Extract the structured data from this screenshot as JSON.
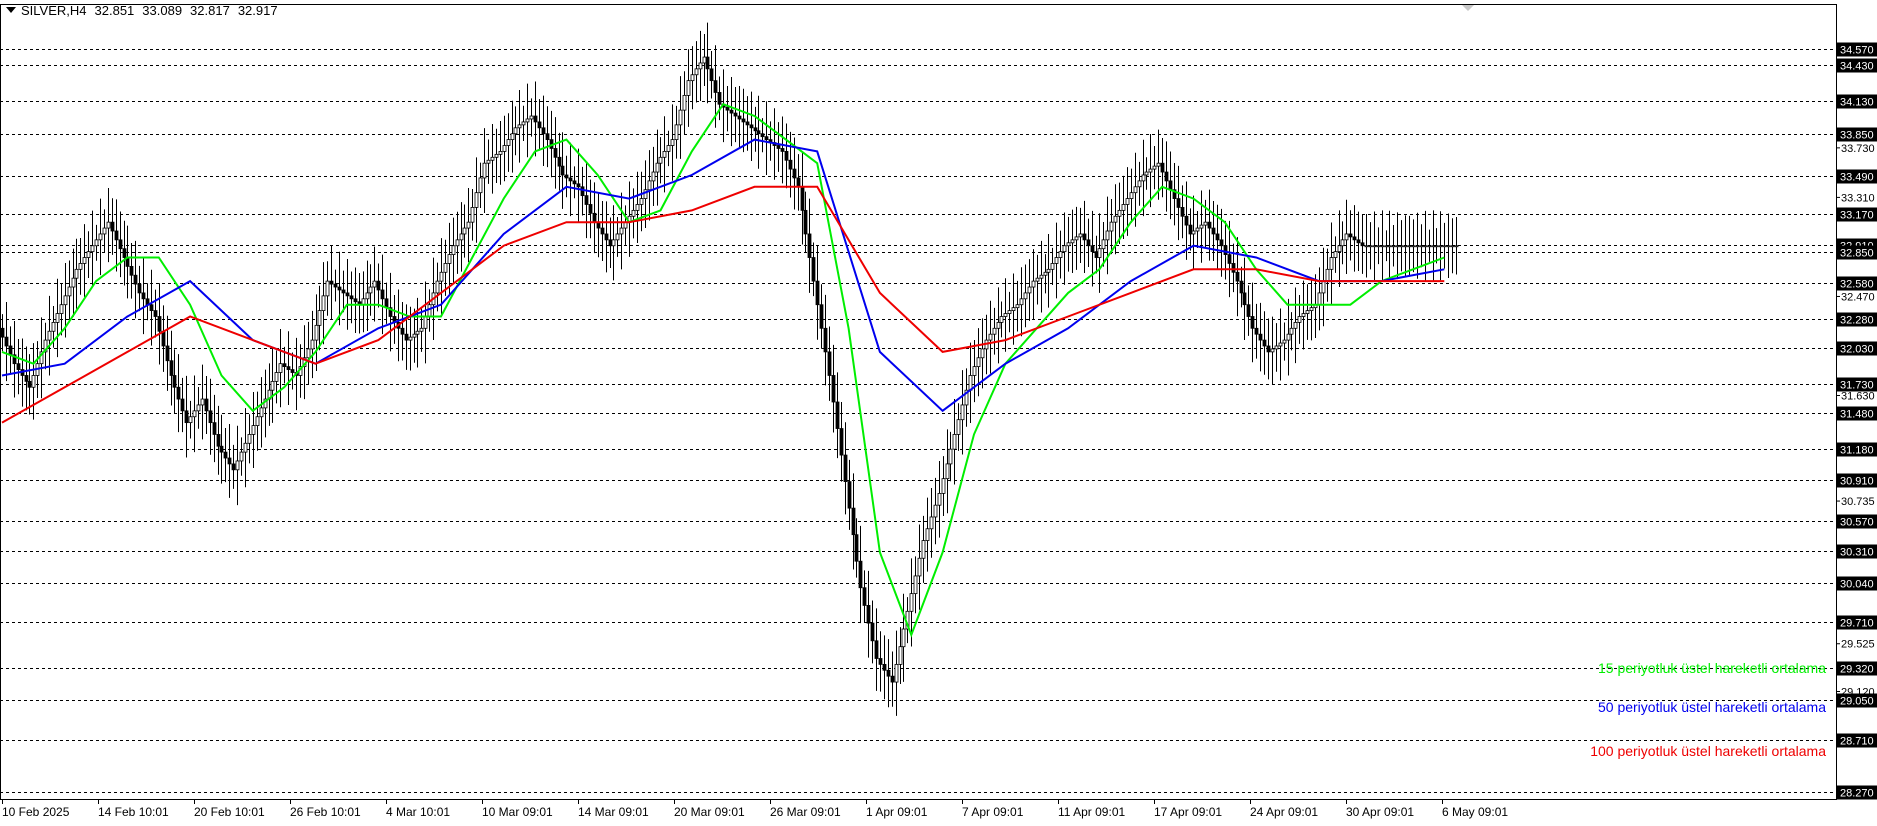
{
  "header": {
    "symbol": "SILVER,H4",
    "open": "32.851",
    "high": "33.089",
    "low": "32.817",
    "close": "32.917"
  },
  "legend": [
    {
      "label": "15 periyotluk üstel hareketli ortalama",
      "color": "#00ee00"
    },
    {
      "label": "50 periyotluk üstel hareketli ortalama",
      "color": "#0000ee"
    },
    {
      "label": "100 periyotluk üstel hareketli ortalama",
      "color": "#ee0000"
    }
  ],
  "chart_data": {
    "type": "line",
    "title": "SILVER,H4",
    "ylim": [
      28.2,
      34.95
    ],
    "grid": "horizontal dashed at marked levels",
    "x_tick_labels": [
      "10 Feb 2025",
      "14 Feb 10:01",
      "20 Feb 10:01",
      "26 Feb 10:01",
      "4 Mar 10:01",
      "10 Mar 09:01",
      "14 Mar 09:01",
      "20 Mar 09:01",
      "26 Mar 09:01",
      "1 Apr 09:01",
      "7 Apr 09:01",
      "11 Apr 09:01",
      "17 Apr 09:01",
      "24 Apr 09:01",
      "30 Apr 09:01",
      "6 May 09:01"
    ],
    "level_labels": [
      "34.570",
      "34.430",
      "34.130",
      "33.850",
      "33.490",
      "33.170",
      "32.910",
      "32.850",
      "32.580",
      "32.280",
      "32.030",
      "31.730",
      "31.480",
      "31.180",
      "30.910",
      "30.570",
      "30.310",
      "30.040",
      "29.710",
      "29.320",
      "29.050",
      "28.710",
      "28.270"
    ],
    "axis_tick_labels": [
      "33.730",
      "33.310",
      "32.470",
      "31.630",
      "30.735",
      "29.525",
      "29.120"
    ],
    "price_path": {
      "x": [
        0,
        2,
        4,
        6,
        8,
        10,
        12,
        14,
        16,
        18,
        20,
        22,
        24,
        26,
        28,
        30,
        32,
        34,
        36,
        38,
        40,
        42,
        44,
        46,
        48,
        50,
        52,
        54,
        56,
        58,
        60,
        62,
        64,
        66,
        68,
        70,
        72,
        74,
        76,
        78,
        80,
        82,
        84,
        86,
        88,
        90,
        92,
        94,
        96,
        98,
        100,
        102,
        104,
        106,
        108,
        110,
        112,
        114,
        116,
        118,
        120,
        122,
        124,
        126,
        128,
        130,
        132,
        134,
        136,
        138,
        140,
        142,
        144,
        146,
        148,
        150,
        152,
        154,
        156,
        158,
        160,
        162,
        164,
        166,
        168,
        170,
        172,
        174,
        176,
        178,
        180,
        182,
        184,
        186
      ],
      "y": [
        32.2,
        31.9,
        31.7,
        32.1,
        32.4,
        32.7,
        32.9,
        33.1,
        32.8,
        32.5,
        32.3,
        31.8,
        31.4,
        31.6,
        31.2,
        31.0,
        31.3,
        31.6,
        31.9,
        31.8,
        32.1,
        32.6,
        32.5,
        32.4,
        32.6,
        32.3,
        32.1,
        32.2,
        32.6,
        32.9,
        33.1,
        33.6,
        33.7,
        33.9,
        34.0,
        33.8,
        33.5,
        33.4,
        33.1,
        32.9,
        33.1,
        33.3,
        33.6,
        33.8,
        34.3,
        34.5,
        34.1,
        34.0,
        33.9,
        33.8,
        33.7,
        33.4,
        32.6,
        31.8,
        30.9,
        30.0,
        29.4,
        29.2,
        29.8,
        30.4,
        30.8,
        31.3,
        31.8,
        32.1,
        32.3,
        32.4,
        32.6,
        32.7,
        32.9,
        33.0,
        32.8,
        33.1,
        33.3,
        33.5,
        33.6,
        33.3,
        33.0,
        33.1,
        32.9,
        32.6,
        32.2,
        32.0,
        32.1,
        32.3,
        32.4,
        32.8,
        33.0,
        32.9,
        32.9,
        32.9,
        32.9,
        32.9,
        32.9,
        32.9
      ]
    },
    "series": [
      {
        "name": "15 periyotluk üstel hareketli ortalama",
        "color": "#00ee00",
        "x": [
          0,
          4,
          8,
          12,
          16,
          20,
          24,
          28,
          32,
          36,
          40,
          44,
          48,
          52,
          56,
          60,
          64,
          68,
          72,
          76,
          80,
          84,
          88,
          92,
          96,
          100,
          104,
          108,
          112,
          116,
          120,
          124,
          128,
          132,
          136,
          140,
          144,
          148,
          152,
          156,
          160,
          164,
          168,
          172,
          176,
          180,
          184
        ],
        "y": [
          32.0,
          31.9,
          32.2,
          32.6,
          32.8,
          32.8,
          32.4,
          31.8,
          31.5,
          31.7,
          32.0,
          32.4,
          32.4,
          32.3,
          32.3,
          32.8,
          33.3,
          33.7,
          33.8,
          33.5,
          33.1,
          33.2,
          33.7,
          34.1,
          34.0,
          33.8,
          33.6,
          32.2,
          30.3,
          29.6,
          30.3,
          31.3,
          31.9,
          32.2,
          32.5,
          32.7,
          33.1,
          33.4,
          33.3,
          33.1,
          32.7,
          32.4,
          32.4,
          32.4,
          32.6,
          32.7,
          32.8
        ]
      },
      {
        "name": "50 periyotluk üstel hareketli ortalama",
        "color": "#0000ee",
        "x": [
          0,
          8,
          16,
          24,
          32,
          40,
          48,
          56,
          64,
          72,
          80,
          88,
          96,
          104,
          112,
          120,
          128,
          136,
          144,
          152,
          160,
          168,
          176,
          184
        ],
        "y": [
          31.8,
          31.9,
          32.3,
          32.6,
          32.1,
          31.9,
          32.2,
          32.4,
          33.0,
          33.4,
          33.3,
          33.5,
          33.8,
          33.7,
          32.0,
          31.5,
          31.9,
          32.2,
          32.6,
          32.9,
          32.8,
          32.6,
          32.6,
          32.7
        ]
      },
      {
        "name": "100 periyotluk üstel hareketli ortalama",
        "color": "#ee0000",
        "x": [
          0,
          8,
          16,
          24,
          32,
          40,
          48,
          56,
          64,
          72,
          80,
          88,
          96,
          104,
          112,
          120,
          128,
          136,
          144,
          152,
          160,
          168,
          176,
          184
        ],
        "y": [
          31.4,
          31.7,
          32.0,
          32.3,
          32.1,
          31.9,
          32.1,
          32.5,
          32.9,
          33.1,
          33.1,
          33.2,
          33.4,
          33.4,
          32.5,
          32.0,
          32.1,
          32.3,
          32.5,
          32.7,
          32.7,
          32.6,
          32.6,
          32.6
        ]
      }
    ]
  }
}
